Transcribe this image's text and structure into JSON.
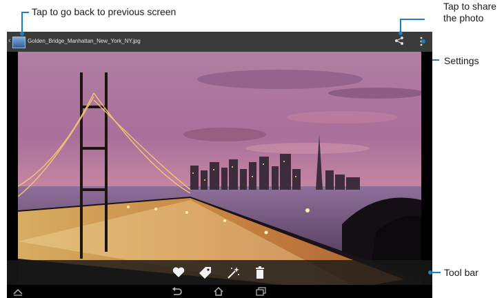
{
  "annotations": {
    "back": "Tap to go back to previous screen",
    "share": "Tap to share the photo",
    "settings": "Settings",
    "toolbar": "Tool bar"
  },
  "gallery": {
    "file_name": "Golden_Bridge_Manhattan_New_York_NY.jpg"
  },
  "icons": {
    "header": [
      "back-icon",
      "app-thumbnail-icon",
      "share-icon",
      "overflow-menu-icon"
    ],
    "toolbar": [
      "heart-icon",
      "tag-icon",
      "magic-wand-icon",
      "trash-icon"
    ],
    "navbar": [
      "collapse-icon",
      "back-icon",
      "home-icon",
      "recent-apps-icon"
    ]
  },
  "colors": {
    "callout_line": "#1b7fc4",
    "header_bar": "#3b3b3b",
    "toolbar": "#191919"
  }
}
